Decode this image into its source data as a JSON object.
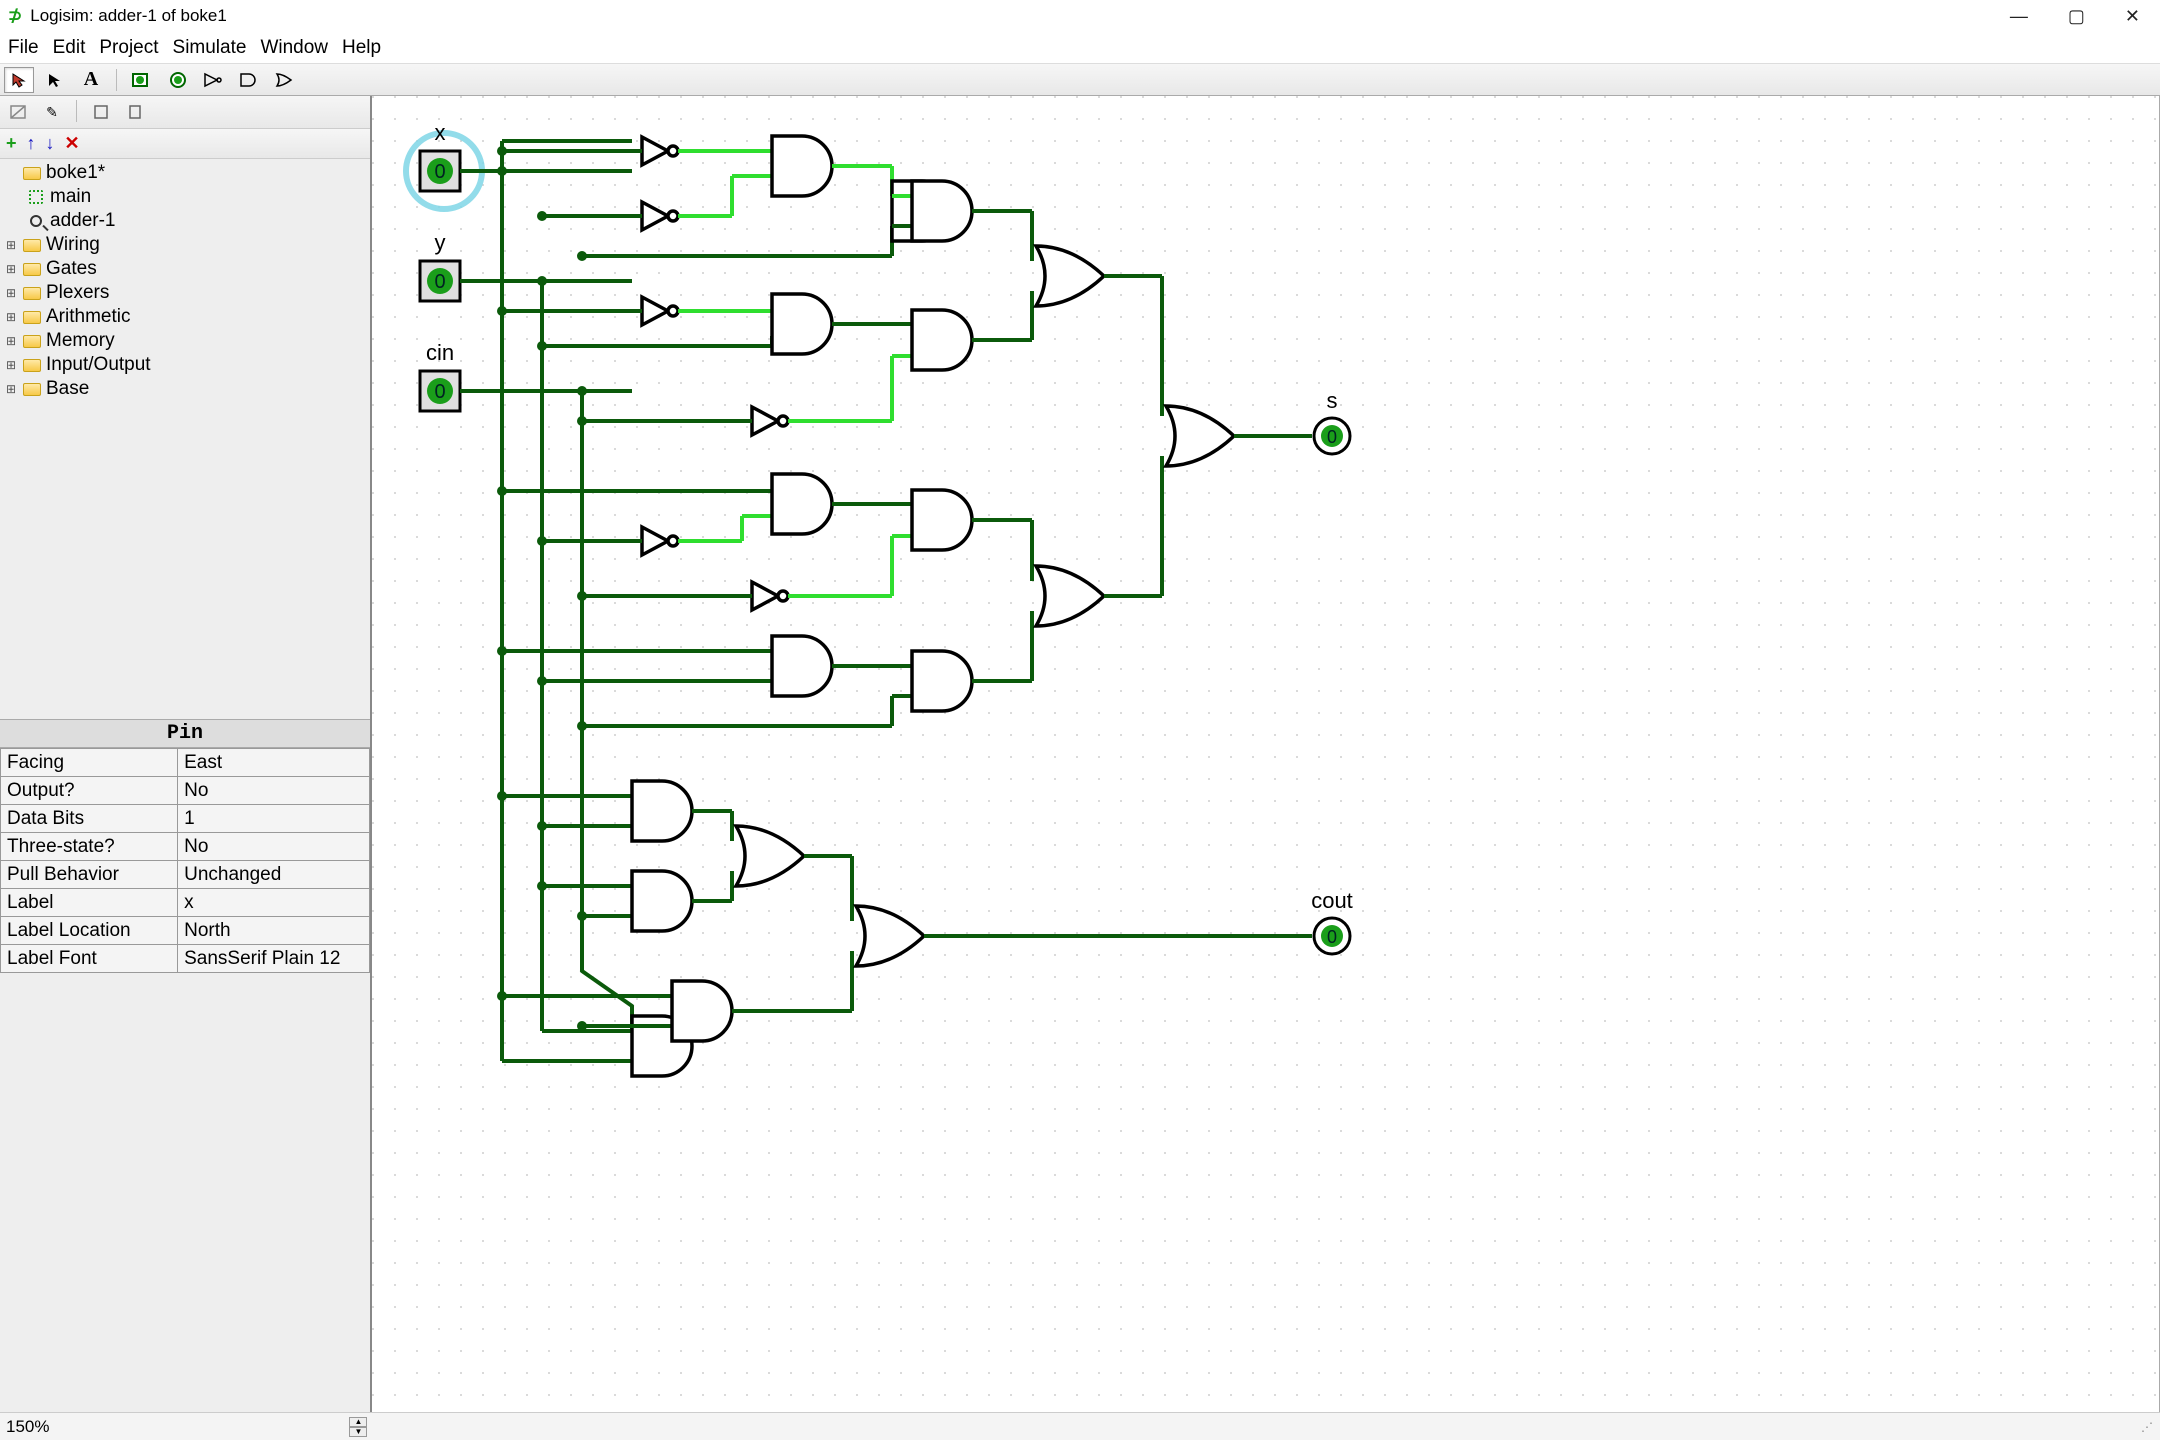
{
  "title": "Logisim: adder-1 of boke1",
  "menu": {
    "file": "File",
    "edit": "Edit",
    "project": "Project",
    "simulate": "Simulate",
    "window": "Window",
    "help": "Help"
  },
  "tree": {
    "project": "boke1*",
    "circ_main": "main",
    "circ_adder": "adder-1",
    "libs": [
      "Wiring",
      "Gates",
      "Plexers",
      "Arithmetic",
      "Memory",
      "Input/Output",
      "Base"
    ]
  },
  "props": {
    "title": "Pin",
    "rows": [
      [
        "Facing",
        "East"
      ],
      [
        "Output?",
        "No"
      ],
      [
        "Data Bits",
        "1"
      ],
      [
        "Three-state?",
        "No"
      ],
      [
        "Pull Behavior",
        "Unchanged"
      ],
      [
        "Label",
        "x"
      ],
      [
        "Label Location",
        "North"
      ],
      [
        "Label Font",
        "SansSerif Plain 12"
      ]
    ]
  },
  "circuit": {
    "inputs": [
      {
        "name": "x",
        "val": "0"
      },
      {
        "name": "y",
        "val": "0"
      },
      {
        "name": "cin",
        "val": "0"
      }
    ],
    "outputs": [
      {
        "name": "s",
        "val": "0"
      },
      {
        "name": "cout",
        "val": "0"
      }
    ]
  },
  "status": {
    "zoom": "150%"
  }
}
